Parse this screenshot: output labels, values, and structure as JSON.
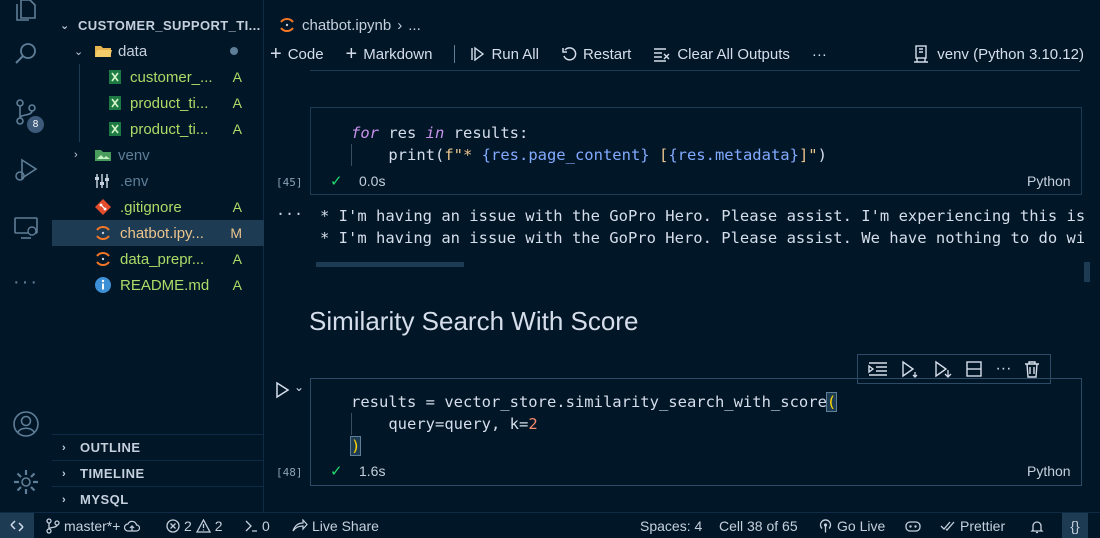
{
  "sidebar": {
    "root_label": "CUSTOMER_SUPPORT_TI...",
    "items": [
      {
        "label": "data",
        "status": ""
      },
      {
        "label": "customer_...",
        "status": "A"
      },
      {
        "label": "product_ti...",
        "status": "A"
      },
      {
        "label": "product_ti...",
        "status": "A"
      },
      {
        "label": "venv",
        "status": ""
      },
      {
        "label": ".env",
        "status": ""
      },
      {
        "label": ".gitignore",
        "status": "A"
      },
      {
        "label": "chatbot.ipy...",
        "status": "M"
      },
      {
        "label": "data_prepr...",
        "status": "A"
      },
      {
        "label": "README.md",
        "status": "A"
      }
    ],
    "sections": [
      "OUTLINE",
      "TIMELINE",
      "MYSQL"
    ]
  },
  "activity": {
    "source_control_badge": "8"
  },
  "editor": {
    "breadcrumb_file": "chatbot.ipynb",
    "breadcrumb_more": "...",
    "toolbar": {
      "code": "Code",
      "markdown": "Markdown",
      "run_all": "Run All",
      "restart": "Restart",
      "clear_all": "Clear All Outputs",
      "more": "···",
      "kernel": "venv (Python 3.10.12)"
    },
    "cell1": {
      "exec": "[45]",
      "duration": "0.0s",
      "language": "Python",
      "output_lines": [
        "* I'm having an issue with the GoPro Hero. Please assist. I'm experiencing this is",
        "* I'm having an issue with the GoPro Hero. Please assist. We have nothing to do wi"
      ],
      "output_more": "···"
    },
    "heading": "Similarity Search With Score",
    "cell2": {
      "exec": "[48]",
      "duration": "1.6s",
      "language": "Python"
    }
  },
  "status": {
    "branch": "master*+",
    "errors": "2",
    "warnings": "2",
    "ports": "0",
    "live_share": "Live Share",
    "spaces": "Spaces: 4",
    "cell": "Cell 38 of 65",
    "go_live": "Go Live",
    "prettier": "Prettier"
  },
  "colors": {
    "background": "#011627",
    "keyword": "#c792ea",
    "string": "#ecc48d",
    "check": "#22da6e"
  }
}
